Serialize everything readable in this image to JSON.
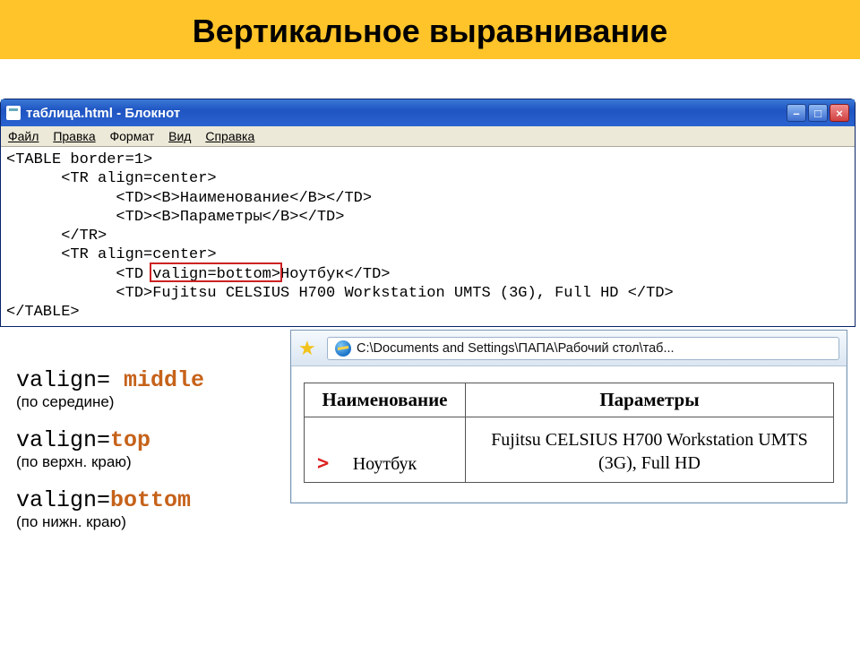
{
  "slide": {
    "title": "Вертикальное выравнивание"
  },
  "notepad": {
    "title": "таблица.html - Блокнот",
    "menu": {
      "file": "Файл",
      "edit": "Правка",
      "format": "Формат",
      "view": "Вид",
      "help": "Справка"
    },
    "code": {
      "l1": "<TABLE border=1>",
      "l2": "      <TR align=center>",
      "l3": "            <TD><B>Наименование</B></TD>",
      "l4": "            <TD><B>Параметры</B></TD>",
      "l5": "      </TR>",
      "l6": "      <TR align=center>",
      "l7a": "            <TD ",
      "l7b": "valign=bottom",
      "l7c": ">Ноутбук</TD>",
      "l8": "            <TD>Fujitsu CELSIUS H700 Workstation UMTS (3G), Full HD </TD>",
      "l9": "</TABLE>"
    }
  },
  "legend": {
    "middle": {
      "attr": "valign= ",
      "val": "middle",
      "desc": "(по середине)"
    },
    "top": {
      "attr": "valign=",
      "val": "top",
      "desc": "(по верхн. краю)"
    },
    "bottom": {
      "attr": "valign=",
      "val": "bottom",
      "desc": "(по нижн. краю)"
    }
  },
  "ie": {
    "path": "C:\\Documents and Settings\\ПАПА\\Рабочий стол\\таб...",
    "table": {
      "h1": "Наименование",
      "h2": "Параметры",
      "c1": "Ноутбук",
      "c2": "Fujitsu CELSIUS H700 Workstation UMTS (3G), Full HD",
      "marker": ">"
    }
  },
  "winbuttons": {
    "min": "–",
    "max": "□",
    "close": "×"
  }
}
